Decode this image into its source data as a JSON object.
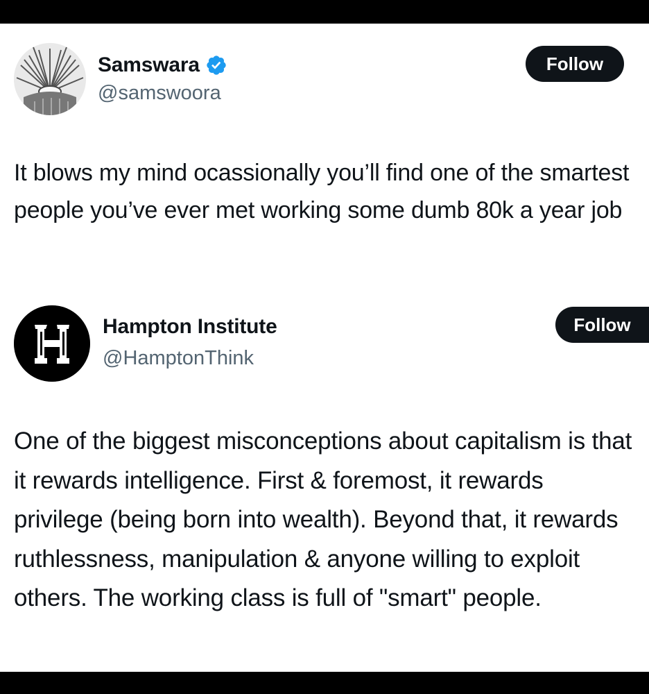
{
  "tweets": [
    {
      "display_name": "Samswara",
      "handle": "@samswoora",
      "verified": true,
      "follow_label": "Follow",
      "avatar_icon": "sunburst-avatar-icon",
      "text": "It blows my mind ocassionally you’ll find one of the smartest people you’ve ever met working some dumb 80k a year job"
    },
    {
      "display_name": "Hampton Institute",
      "handle": "@HamptonThink",
      "verified": false,
      "follow_label": "Follow",
      "avatar_icon": "letter-h-logo-icon",
      "text": "One of the biggest misconceptions about capitalism is that it rewards intelligence. First & foremost, it rewards privilege (being born into wealth). Beyond that, it rewards ruthlessness, manipulation & anyone willing to exploit others. The working class is full of \"smart\" people."
    }
  ],
  "colors": {
    "text_primary": "#0f1419",
    "text_secondary": "#536471",
    "verified_blue": "#1d9bf0",
    "button_bg": "#0f1419",
    "button_text": "#ffffff",
    "frame": "#000000"
  }
}
